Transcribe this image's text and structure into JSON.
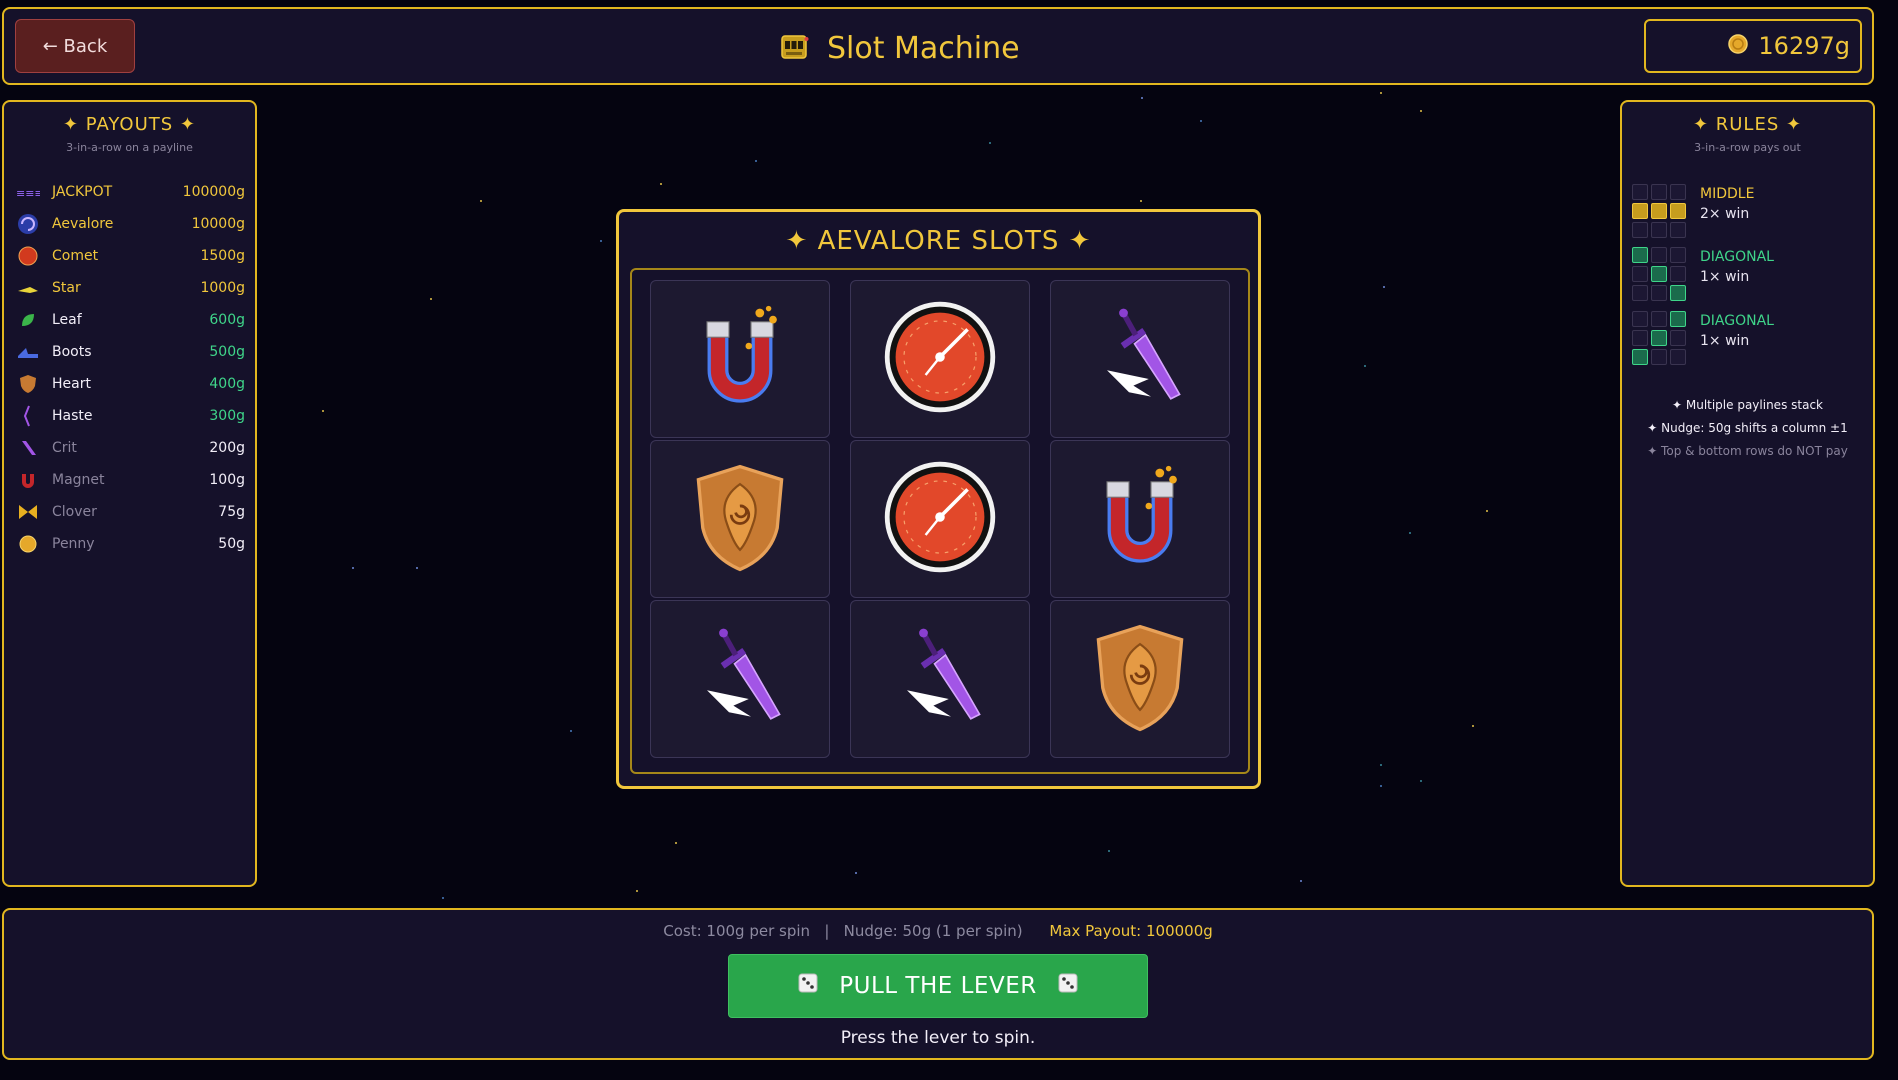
{
  "header": {
    "back_label": "← Back",
    "title": "Slot Machine",
    "gold": "16297g"
  },
  "payouts": {
    "title": "✦  PAYOUTS  ✦",
    "subtitle": "3-in-a-row on a payline",
    "items": [
      {
        "name": "JACKPOT",
        "value": "100000g",
        "name_color": "#f1c73c",
        "value_color": "#f1c73c"
      },
      {
        "name": "Aevalore",
        "value": "10000g",
        "name_color": "#f1c73c",
        "value_color": "#f1c73c"
      },
      {
        "name": "Comet",
        "value": "1500g",
        "name_color": "#f1c73c",
        "value_color": "#f1c73c"
      },
      {
        "name": "Star",
        "value": "1000g",
        "name_color": "#f1c73c",
        "value_color": "#f1c73c"
      },
      {
        "name": "Leaf",
        "value": "600g",
        "name_color": "#f2eef8",
        "value_color": "#3fd58a"
      },
      {
        "name": "Boots",
        "value": "500g",
        "name_color": "#f2eef8",
        "value_color": "#3fd58a"
      },
      {
        "name": "Heart",
        "value": "400g",
        "name_color": "#f2eef8",
        "value_color": "#3fd58a"
      },
      {
        "name": "Haste",
        "value": "300g",
        "name_color": "#f2eef8",
        "value_color": "#3fd58a"
      },
      {
        "name": "Crit",
        "value": "200g",
        "name_color": "#8a849c",
        "value_color": "#f2eef8"
      },
      {
        "name": "Magnet",
        "value": "100g",
        "name_color": "#8a849c",
        "value_color": "#f2eef8"
      },
      {
        "name": "Clover",
        "value": "75g",
        "name_color": "#8a849c",
        "value_color": "#f2eef8"
      },
      {
        "name": "Penny",
        "value": "50g",
        "name_color": "#8a849c",
        "value_color": "#f2eef8"
      }
    ]
  },
  "rules": {
    "title": "✦  RULES  ✦",
    "subtitle": "3-in-a-row pays out",
    "lines": [
      {
        "name": "MIDDLE",
        "mult": "2× win",
        "color": "#f1c73c"
      },
      {
        "name": "DIAGONAL",
        "mult": "1× win",
        "color": "#3fd58a"
      },
      {
        "name": "DIAGONAL",
        "mult": "1× win",
        "color": "#3fd58a"
      }
    ],
    "notes": [
      "✦ Multiple paylines stack",
      "✦ Nudge: 50g shifts a column ±1",
      "✦ Top & bottom rows do NOT pay"
    ]
  },
  "machine": {
    "title": "✦  AEVALORE SLOTS  ✦",
    "grid": [
      [
        "magnet",
        "gauge",
        "sword"
      ],
      [
        "shield",
        "gauge",
        "magnet"
      ],
      [
        "sword",
        "sword",
        "shield"
      ]
    ]
  },
  "bottom": {
    "cost_text": "Cost: 100g per spin   |   Nudge: 50g (1 per spin)",
    "max_payout": "Max Payout: 100000g",
    "lever_label": "PULL THE LEVER",
    "status": "Press the lever to spin."
  },
  "colors": {
    "accent": "#f1c73c",
    "win_green": "#3fd58a",
    "button_green": "#29a64b",
    "back_red": "#5a1f1f"
  }
}
